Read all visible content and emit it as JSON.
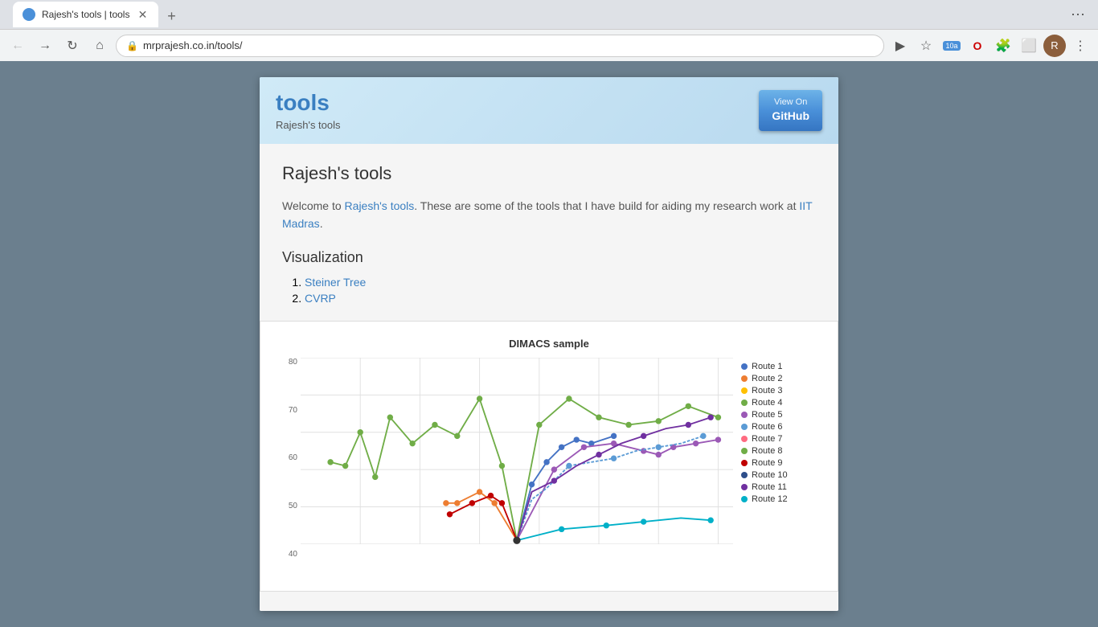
{
  "browser": {
    "tab_title": "Rajesh's tools | tools",
    "tab_new_label": "+",
    "address": "mrprajesh.co.in/tools/",
    "nav_more_label": "⋮"
  },
  "header": {
    "title": "tools",
    "subtitle": "Rajesh's tools",
    "github_btn_line1": "View On",
    "github_btn_line2": "GitHub"
  },
  "page": {
    "heading": "Rajesh's tools",
    "intro": "Welcome to Rajesh's tools. These are some of the tools that I have build for aiding my research work at IIT Madras.",
    "intro_link1": "Rajesh's tools",
    "intro_link2": "IIT Madras",
    "section_vis": "Visualization",
    "tools": [
      {
        "label": "Steiner Tree",
        "href": "#"
      },
      {
        "label": "CVRP",
        "href": "#"
      }
    ]
  },
  "chart": {
    "title": "DIMACS sample",
    "y_labels": [
      "80",
      "70",
      "60",
      "50",
      "40"
    ],
    "routes": [
      {
        "label": "Route 1",
        "color": "#4472c4"
      },
      {
        "label": "Route 2",
        "color": "#ed7d31"
      },
      {
        "label": "Route 3",
        "color": "#ffc000"
      },
      {
        "label": "Route 4",
        "color": "#70ad47"
      },
      {
        "label": "Route 5",
        "color": "#9b59b6"
      },
      {
        "label": "Route 6",
        "color": "#5b9bd5"
      },
      {
        "label": "Route 7",
        "color": "#ff6b81"
      },
      {
        "label": "Route 8",
        "color": "#70ad47"
      },
      {
        "label": "Route 9",
        "color": "#c00000"
      },
      {
        "label": "Route 10",
        "color": "#2e4e8a"
      },
      {
        "label": "Route 11",
        "color": "#7030a0"
      },
      {
        "label": "Route 12",
        "color": "#4472c4"
      }
    ]
  }
}
